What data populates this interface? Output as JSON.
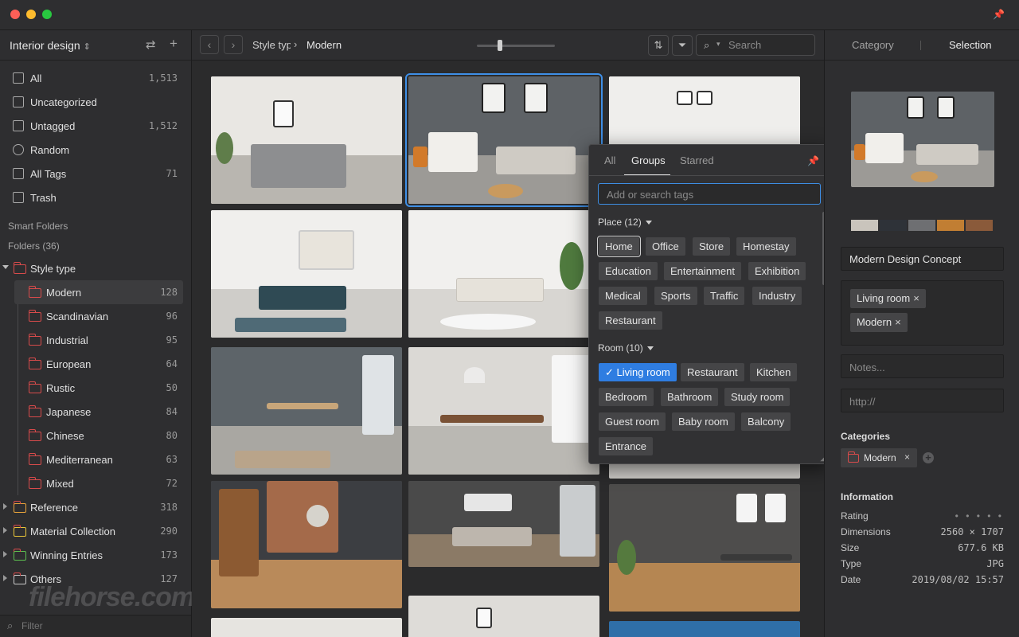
{
  "window": {
    "traffic_lights": [
      "#fe5f57",
      "#febc2e",
      "#28c840"
    ]
  },
  "sidebar": {
    "library_name": "Interior design",
    "items": [
      {
        "label": "All",
        "count": "1,513",
        "icon": "all-items-icon"
      },
      {
        "label": "Uncategorized",
        "count": "",
        "icon": "uncategorized-icon"
      },
      {
        "label": "Untagged",
        "count": "1,512",
        "icon": "untagged-icon"
      },
      {
        "label": "Random",
        "count": "",
        "icon": "random-icon"
      },
      {
        "label": "All Tags",
        "count": "71",
        "icon": "tags-icon"
      },
      {
        "label": "Trash",
        "count": "",
        "icon": "trash-icon"
      }
    ],
    "smart_folders_label": "Smart Folders",
    "folders_label": "Folders (36)",
    "style_type": {
      "label": "Style type",
      "children": [
        {
          "label": "Modern",
          "count": "128"
        },
        {
          "label": "Scandinavian",
          "count": "96"
        },
        {
          "label": "Industrial",
          "count": "95"
        },
        {
          "label": "European",
          "count": "64"
        },
        {
          "label": "Rustic",
          "count": "50"
        },
        {
          "label": "Japanese",
          "count": "84"
        },
        {
          "label": "Chinese",
          "count": "80"
        },
        {
          "label": "Mediterranean",
          "count": "63"
        },
        {
          "label": "Mixed",
          "count": "72"
        }
      ]
    },
    "top_folders": [
      {
        "label": "Reference",
        "count": "318",
        "color": "#e8a33a"
      },
      {
        "label": "Material Collection",
        "count": "290",
        "color": "#e8c53a"
      },
      {
        "label": "Winning Entries",
        "count": "173",
        "color": "#5cc04f"
      },
      {
        "label": "Others",
        "count": "127",
        "color": "#c9c9c9"
      }
    ],
    "filter_placeholder": "Filter",
    "watermark": "filehorse.com"
  },
  "toolbar": {
    "breadcrumb_parent": "Style type",
    "breadcrumb_current": "Modern",
    "search_placeholder": "Search"
  },
  "tag_popover": {
    "tabs": [
      "All",
      "Groups",
      "Starred"
    ],
    "active_tab": "Groups",
    "search_placeholder": "Add or search tags",
    "groups": [
      {
        "title": "Place (12)",
        "tags": [
          "Home",
          "Office",
          "Store",
          "Homestay",
          "Education",
          "Entertainment",
          "Exhibition",
          "Medical",
          "Sports",
          "Traffic",
          "Industry",
          "Restaurant"
        ]
      },
      {
        "title": "Room (10)",
        "tags": [
          "Living room",
          "Restaurant",
          "Kitchen",
          "Bedroom",
          "Bathroom",
          "Study room",
          "Guest room",
          "Baby room",
          "Balcony",
          "Entrance"
        ]
      }
    ]
  },
  "inspector": {
    "tabs": [
      "Category",
      "Selection"
    ],
    "active_tab": "Selection",
    "palette": [
      "#c9c4bc",
      "#2e3238",
      "#6e6f72",
      "#c17e33",
      "#8a5a3a"
    ],
    "title": "Modern Design Concept",
    "tags": [
      "Living room",
      "Modern"
    ],
    "notes_placeholder": "Notes...",
    "url_placeholder": "http://",
    "categories_label": "Categories",
    "category": "Modern",
    "information_label": "Information",
    "info": [
      {
        "key": "Rating",
        "value": "• • • • •"
      },
      {
        "key": "Dimensions",
        "value": "2560 × 1707"
      },
      {
        "key": "Size",
        "value": "677.6 KB"
      },
      {
        "key": "Type",
        "value": "JPG"
      },
      {
        "key": "Date",
        "value": "2019/08/02 15:57"
      }
    ]
  }
}
